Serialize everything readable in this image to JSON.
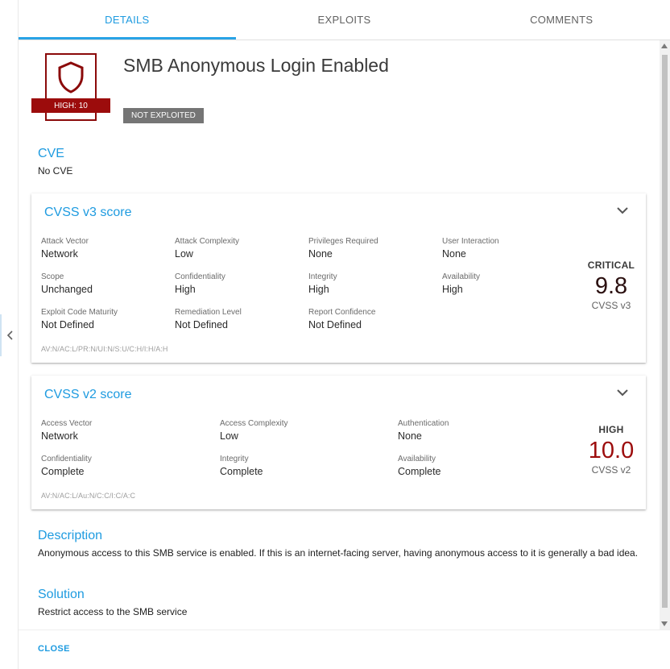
{
  "tabs": [
    {
      "label": "DETAILS"
    },
    {
      "label": "EXPLOITS"
    },
    {
      "label": "COMMENTS"
    }
  ],
  "vulnerability": {
    "title": "SMB Anonymous Login Enabled",
    "severity_label": "HIGH: 10",
    "exploit_status": "NOT EXPLOITED",
    "severity_color": "#8b0a0a"
  },
  "cve": {
    "heading": "CVE",
    "value": "No CVE"
  },
  "cvss3": {
    "heading": "CVSS v3 score",
    "metrics": [
      {
        "label": "Attack Vector",
        "value": "Network"
      },
      {
        "label": "Attack Complexity",
        "value": "Low"
      },
      {
        "label": "Privileges Required",
        "value": "None"
      },
      {
        "label": "User Interaction",
        "value": "None"
      },
      {
        "label": "Scope",
        "value": "Unchanged"
      },
      {
        "label": "Confidentiality",
        "value": "High"
      },
      {
        "label": "Integrity",
        "value": "High"
      },
      {
        "label": "Availability",
        "value": "High"
      },
      {
        "label": "Exploit Code Maturity",
        "value": "Not Defined"
      },
      {
        "label": "Remediation Level",
        "value": "Not Defined"
      },
      {
        "label": "Report Confidence",
        "value": "Not Defined"
      }
    ],
    "vector": "AV:N/AC:L/PR:N/UI:N/S:U/C:H/I:H/A:H",
    "severity": "CRITICAL",
    "score": "9.8",
    "version": "CVSS v3",
    "score_color": "#2b1010"
  },
  "cvss2": {
    "heading": "CVSS v2 score",
    "metrics": [
      {
        "label": "Access Vector",
        "value": "Network"
      },
      {
        "label": "Access Complexity",
        "value": "Low"
      },
      {
        "label": "Authentication",
        "value": "None"
      },
      {
        "label": "Confidentiality",
        "value": "Complete"
      },
      {
        "label": "Integrity",
        "value": "Complete"
      },
      {
        "label": "Availability",
        "value": "Complete"
      }
    ],
    "vector": "AV:N/AC:L/Au:N/C:C/I:C/A:C",
    "severity": "HIGH",
    "score": "10.0",
    "version": "CVSS v2",
    "score_color": "#9c0c0c"
  },
  "description": {
    "heading": "Description",
    "text": "Anonymous access to this SMB service is enabled. If this is an internet-facing server, having anonymous access to it is generally a bad idea."
  },
  "solution": {
    "heading": "Solution",
    "text": "Restrict access to the SMB service"
  },
  "footer": {
    "close_label": "CLOSE"
  },
  "icons": {
    "severity": "shield-icon",
    "expand": "chevron-down-icon",
    "collapse_panel": "chevron-left-icon"
  }
}
